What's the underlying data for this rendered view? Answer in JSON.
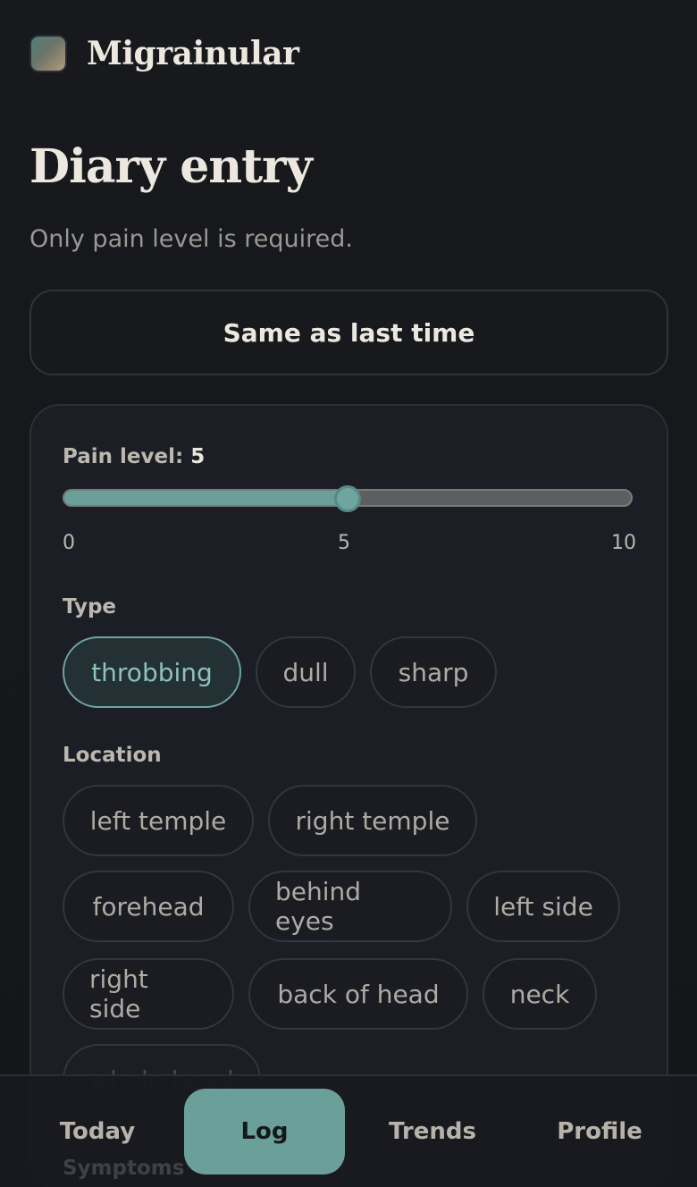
{
  "app": {
    "name": "Migrainular"
  },
  "page": {
    "title": "Diary entry",
    "subtitle": "Only pain level is required."
  },
  "actions": {
    "same_as_last": "Same as last time"
  },
  "pain": {
    "label": "Pain level: ",
    "value": "5",
    "min": "0",
    "mid": "5",
    "max": "10",
    "level_fraction": 0.5
  },
  "type": {
    "label": "Type",
    "options": [
      "throbbing",
      "dull",
      "sharp"
    ],
    "selected": "throbbing"
  },
  "location": {
    "label": "Location",
    "options": [
      "left temple",
      "right temple",
      "forehead",
      "behind eyes",
      "left side",
      "right side",
      "back of head",
      "neck",
      "whole head"
    ]
  },
  "next_section": {
    "label": "Symptoms"
  },
  "nav": {
    "items": [
      "Today",
      "Log",
      "Trends",
      "Profile"
    ],
    "active": "Log"
  },
  "colors": {
    "accent": "#6a9f9a",
    "background": "#16181c",
    "card": "#1c1e25"
  }
}
